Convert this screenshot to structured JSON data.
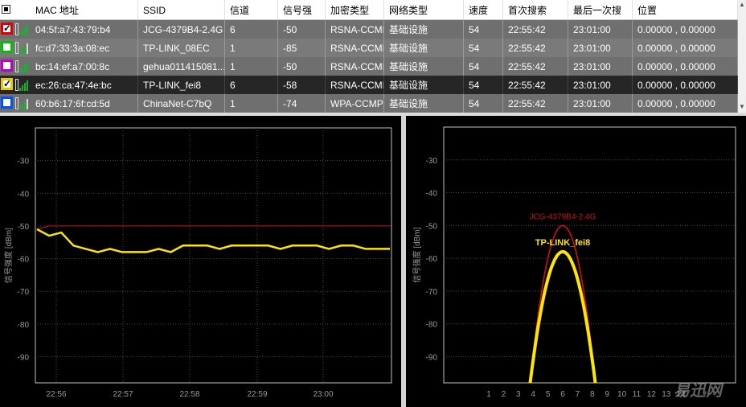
{
  "table": {
    "columns": [
      "MAC 地址",
      "SSID",
      "信道",
      "信号强",
      "加密类型",
      "网络类型",
      "速度",
      "首次搜索",
      "最后一次搜",
      "位置"
    ],
    "rows": [
      {
        "checked": true,
        "color": "#e00000",
        "signal_bars": 3,
        "mac": "04:5f:a7:43:79:b4",
        "ssid": "JCG-4379B4-2.4G",
        "channel": "6",
        "rssi": "-50",
        "security": "RSNA-CCMP",
        "network_type": "基础设施",
        "speed": "54",
        "first_seen": "22:55:42",
        "last_seen": "23:01:00",
        "location": "0.00000 , 0.00000"
      },
      {
        "checked": false,
        "color": "#00c000",
        "signal_bars": 2,
        "mac": "fc:d7:33:3a:08:ec",
        "ssid": "TP-LINK_08EC",
        "channel": "1",
        "rssi": "-85",
        "security": "RSNA-CCMP",
        "network_type": "基础设施",
        "speed": "54",
        "first_seen": "22:55:42",
        "last_seen": "23:01:00",
        "location": "0.00000 , 0.00000"
      },
      {
        "checked": false,
        "color": "#c000c0",
        "signal_bars": 3,
        "mac": "bc:14:ef:a7:00:8c",
        "ssid": "gehua011415081...",
        "channel": "1",
        "rssi": "-50",
        "security": "RSNA-CCMP",
        "network_type": "基础设施",
        "speed": "54",
        "first_seen": "22:55:42",
        "last_seen": "23:01:00",
        "location": "0.00000 , 0.00000"
      },
      {
        "checked": true,
        "color": "#e8c800",
        "signal_bars": 3,
        "mac": "ec:26:ca:47:4e:bc",
        "ssid": "TP-LINK_fei8",
        "channel": "6",
        "rssi": "-58",
        "security": "RSNA-CCMP",
        "network_type": "基础设施",
        "speed": "54",
        "first_seen": "22:55:42",
        "last_seen": "23:01:00",
        "location": "0.00000 , 0.00000"
      },
      {
        "checked": false,
        "color": "#0050ff",
        "signal_bars": 2,
        "mac": "60:b6:17:6f:cd:5d",
        "ssid": "ChinaNet-C7bQ",
        "channel": "1",
        "rssi": "-74",
        "security": "WPA-CCMP",
        "network_type": "基础设施",
        "speed": "54",
        "first_seen": "22:55:42",
        "last_seen": "23:01:00",
        "location": "0.00000 , 0.00000"
      }
    ],
    "selected_index": 3
  },
  "chart_data": [
    {
      "type": "line",
      "ylabel": "信号强度 [dBm]",
      "ylim": [
        -98,
        -20
      ],
      "yticks": [
        -30,
        -40,
        -50,
        -60,
        -70,
        -80,
        -90
      ],
      "xticks": [
        "22:56",
        "22:57",
        "22:58",
        "22:59",
        "23:00"
      ],
      "grid": true,
      "series": [
        {
          "name": "JCG-4379B4-2.4G",
          "color": "#d01010",
          "values": [
            -51,
            -50,
            -50,
            -50,
            -50,
            -50,
            -50,
            -50,
            -50,
            -50,
            -50,
            -50,
            -50,
            -50,
            -50,
            -50,
            -50,
            -50,
            -50,
            -50,
            -50,
            -50,
            -50,
            -50,
            -50,
            -50,
            -50,
            -50,
            -50,
            -50
          ]
        },
        {
          "name": "TP-LINK_fei8",
          "color": "#ffe600",
          "values": [
            -51,
            -53,
            -52,
            -56,
            -57,
            -58,
            -57,
            -58,
            -58,
            -58,
            -57,
            -58,
            -56,
            -56,
            -56,
            -57,
            -56,
            -56,
            -56,
            -56,
            -57,
            -56,
            -56,
            -56,
            -57,
            -56,
            -56,
            -57,
            -57,
            -57
          ]
        }
      ]
    },
    {
      "type": "line",
      "ylabel": "信号强度 [dBm]",
      "ylim": [
        -98,
        -20
      ],
      "yticks": [
        -30,
        -40,
        -50,
        -60,
        -70,
        -80,
        -90
      ],
      "xticks": [
        "1",
        "2",
        "3",
        "4",
        "5",
        "6",
        "7",
        "8",
        "9",
        "10",
        "11",
        "12",
        "13",
        "14"
      ],
      "grid": true,
      "series": [
        {
          "name": "JCG-4379B4-2.4G",
          "color": "#d01010",
          "channel": 6,
          "peak": -50
        },
        {
          "name": "TP-LINK_fei8",
          "color": "#ffe600",
          "channel": 6,
          "peak": -58
        }
      ]
    }
  ],
  "watermark": "易迅网"
}
